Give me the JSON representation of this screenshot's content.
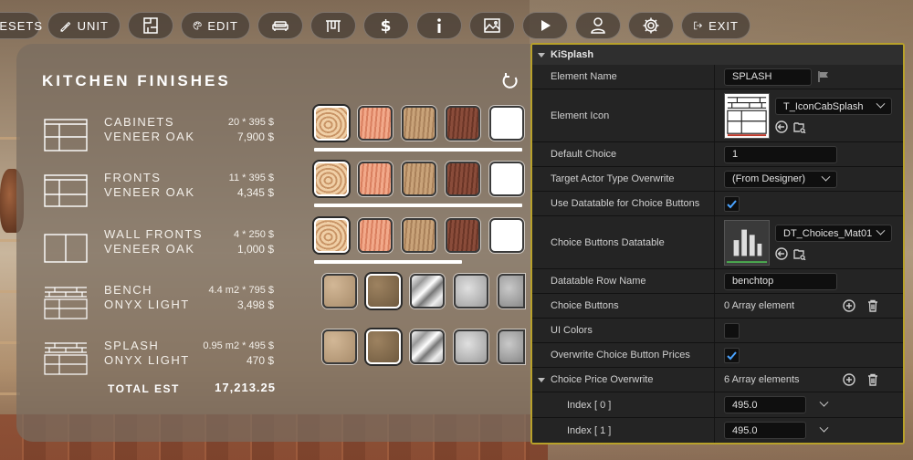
{
  "toolbar": {
    "items": [
      {
        "name": "presets-button",
        "label": "RESETS",
        "icon": "none"
      },
      {
        "name": "unit-button",
        "label": "UNIT",
        "icon": "ruler-pencil-icon"
      },
      {
        "name": "floorplan-button",
        "label": "",
        "icon": "floorplan-icon"
      },
      {
        "name": "edit-button",
        "label": "EDIT",
        "icon": "palette-icon"
      },
      {
        "name": "sofa-button",
        "label": "",
        "icon": "sofa-icon"
      },
      {
        "name": "table-button",
        "label": "",
        "icon": "table-icon"
      },
      {
        "name": "price-button",
        "label": "",
        "icon": "dollar-icon"
      },
      {
        "name": "info-button",
        "label": "",
        "icon": "info-icon"
      },
      {
        "name": "image-button",
        "label": "",
        "icon": "image-icon"
      },
      {
        "name": "play-button",
        "label": "",
        "icon": "play-icon"
      },
      {
        "name": "user-button",
        "label": "",
        "icon": "user-icon"
      },
      {
        "name": "settings-button",
        "label": "",
        "icon": "gear-icon"
      },
      {
        "name": "exit-button",
        "label": "EXIT",
        "icon": "exit-icon"
      }
    ]
  },
  "finishes": {
    "title": "KITCHEN FINISHES",
    "rows": [
      {
        "name": "CABINETS",
        "material": "VENEER OAK",
        "qty": "20  * 395 $",
        "price": "7,900 $",
        "icon": "cabinet-elevation-icon"
      },
      {
        "name": "FRONTS",
        "material": "VENEER OAK",
        "qty": "11  * 395 $",
        "price": "4,345 $",
        "icon": "fronts-elevation-icon"
      },
      {
        "name": "WALL FRONTS",
        "material": "VENEER OAK",
        "qty": "4  * 250 $",
        "price": "1,000 $",
        "icon": "wall-cabinet-icon"
      },
      {
        "name": "BENCH",
        "material": "ONYX LIGHT",
        "qty": "4.4 m2 * 795 $",
        "price": "3,498 $",
        "icon": "bench-brick-icon"
      },
      {
        "name": "SPLASH",
        "material": "ONYX LIGHT",
        "qty": "0.95 m2 * 495 $",
        "price": "470 $",
        "icon": "splash-brick-icon"
      }
    ],
    "total_label": "TOTAL EST",
    "total_value": "17,213.25"
  },
  "details": {
    "category": "KiSplash",
    "element_name_label": "Element Name",
    "element_name_value": "SPLASH",
    "element_icon_label": "Element Icon",
    "element_icon_asset": "T_IconCabSplash",
    "default_choice_label": "Default Choice",
    "default_choice_value": "1",
    "target_actor_label": "Target Actor Type Overwrite",
    "target_actor_value": "(From Designer)",
    "use_datatable_label": "Use Datatable for Choice Buttons",
    "choice_datatable_label": "Choice Buttons Datatable",
    "choice_datatable_asset": "DT_Choices_Mat01",
    "row_name_label": "Datatable Row Name",
    "row_name_value": "benchtop",
    "choice_buttons_label": "Choice Buttons",
    "choice_buttons_value": "0 Array element",
    "ui_colors_label": "UI Colors",
    "overwrite_prices_label": "Overwrite Choice Button Prices",
    "price_overwrite_label": "Choice Price Overwrite",
    "price_overwrite_value": "6 Array elements",
    "index0_label": "Index [ 0 ]",
    "index0_value": "495.0",
    "index1_label": "Index [ 1 ]",
    "index1_value": "495.0"
  }
}
